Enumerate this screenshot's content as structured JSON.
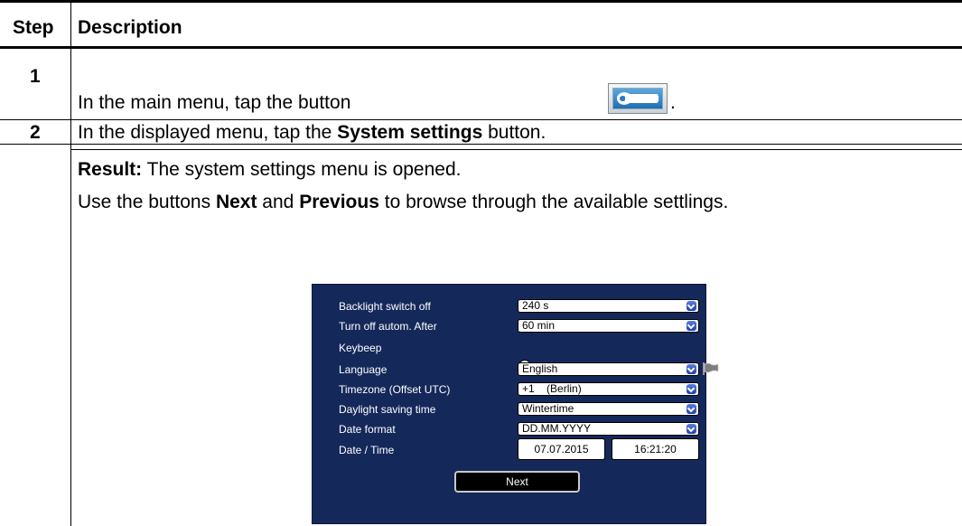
{
  "table": {
    "header": {
      "step": "Step",
      "description": "Description"
    },
    "rows": [
      {
        "step": "1",
        "text": "In the main menu, tap the button",
        "suffix": "."
      },
      {
        "step": "2",
        "pre": "In the displayed menu, tap the ",
        "bold": "System settings",
        "post": " button."
      }
    ],
    "result": {
      "label": "Result:",
      "text": " The system settings menu is opened.",
      "line2_pre": "Use the buttons ",
      "line2_b1": "Next",
      "line2_mid": " and ",
      "line2_b2": "Previous",
      "line2_post": " to browse through the available settlings."
    }
  },
  "icons": {
    "wrench_button": "wrench-icon",
    "flag": "flag-icon"
  },
  "settings_panel": {
    "background": "#14285a",
    "rows": [
      {
        "label": "Backlight switch off",
        "value": "240 s"
      },
      {
        "label": "Turn off autom. After",
        "value": "60 min"
      },
      {
        "label": "Keybeep",
        "value": ""
      },
      {
        "label": "Language",
        "value": "English"
      },
      {
        "label": "Timezone (Offset UTC)",
        "value": "+1    (Berlin)"
      },
      {
        "label": "Daylight saving time",
        "value": "Wintertime"
      },
      {
        "label": "Date format",
        "value": "DD.MM.YYYY"
      },
      {
        "label": "Date / Time",
        "value": ""
      }
    ],
    "date": "07.07.2015",
    "time": "16:21:20",
    "next_label": "Next"
  }
}
